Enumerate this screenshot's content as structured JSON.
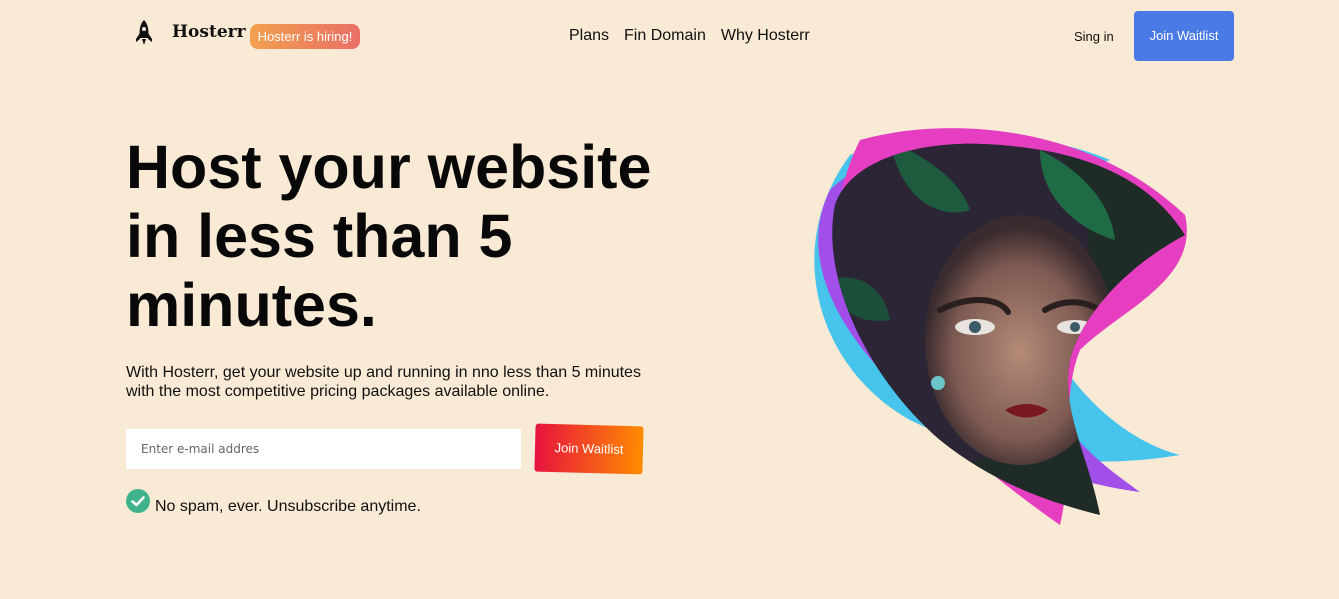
{
  "header": {
    "logo_text": "Hosterr",
    "hiring_badge": "Hosterr is hiring!",
    "nav": [
      "Plans",
      "Fin Domain",
      "Why Hosterr"
    ],
    "signin": "Sing in",
    "join_waitlist": "Join Waitlist"
  },
  "hero": {
    "title_lines": [
      "Host your website",
      "in less than 5",
      "minutes."
    ],
    "subtitle_line1": "With Hosterr, get your website up and running in nno less than 5 minutes",
    "subtitle_line2": "with the most competitive pricing packages available online.",
    "email_placeholder": "Enter e-mail addres",
    "join_waitlist": "Join Waitlist",
    "no_spam": "No spam, ever. Unsubscribe anytime."
  },
  "colors": {
    "background": "#f8ead5",
    "primary_button": "#4a7ae6",
    "check": "#3fb48a",
    "art_pink": "#e63ec0",
    "art_purple": "#a24ee8",
    "art_cyan": "#47c4ec"
  },
  "icons": {
    "logo": "rocket-icon",
    "check": "check-circle-icon"
  }
}
